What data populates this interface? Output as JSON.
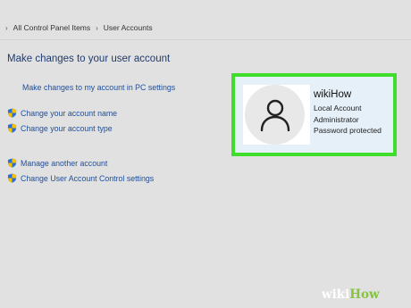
{
  "breadcrumb": {
    "items": [
      "All Control Panel Items",
      "User Accounts"
    ]
  },
  "main": {
    "title": "Make changes to your user account",
    "pc_settings_link": "Make changes to my account in PC settings",
    "tasks": [
      "Change your account name",
      "Change your account type",
      "Manage another account",
      "Change User Account Control settings"
    ]
  },
  "account_card": {
    "name": "wikiHow",
    "details": [
      "Local Account",
      "Administrator",
      "Password protected"
    ],
    "highlight_color": "#3fde2c"
  },
  "watermark": {
    "part1": "wiki",
    "part2": "How"
  },
  "icons": {
    "uac": "uac-shield-icon",
    "avatar": "user-avatar-icon"
  }
}
